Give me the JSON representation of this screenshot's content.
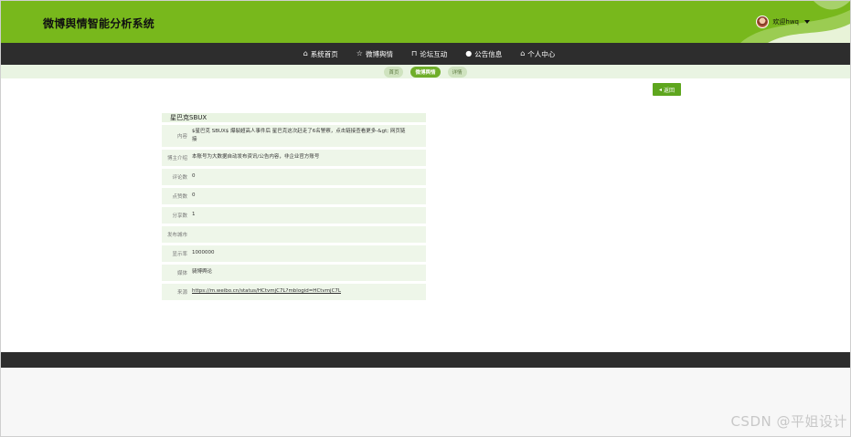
{
  "header": {
    "title": "微博舆情智能分析系统",
    "user_text": "欢迎hwq"
  },
  "nav": {
    "items": [
      {
        "label": "系统首页",
        "icon": "home-icon"
      },
      {
        "label": "微博舆情",
        "icon": "star-icon"
      },
      {
        "label": "论坛互动",
        "icon": "lock-icon"
      },
      {
        "label": "公告信息",
        "icon": "info-icon"
      },
      {
        "label": "个人中心",
        "icon": "home-icon"
      }
    ]
  },
  "breadcrumb": {
    "items": [
      "首页",
      "微博舆情",
      "详情"
    ]
  },
  "back_button": "返回",
  "detail": {
    "title": "星巴克SBUX",
    "rows": [
      {
        "label": "内容",
        "value": "$星巴克 SBUX$ 爆裂超高人事件后 星巴克这次赶走了6名警察，点击链接查看更多-&gt; 网页链接"
      },
      {
        "label": "博主介绍",
        "value": "本账号为大数据自动发布资讯/公告内容，非企业官方账号"
      },
      {
        "label": "评论数",
        "value": "0"
      },
      {
        "label": "点赞数",
        "value": "0"
      },
      {
        "label": "分享数",
        "value": "1"
      },
      {
        "label": "发布城市",
        "value": ""
      },
      {
        "label": "显示率",
        "value": "1000000"
      },
      {
        "label": "媒体",
        "value": "骑博舆论"
      },
      {
        "label": "来源",
        "value": "https://m.weibo.cn/status/HCtvmjC7L?mblogid=HCtvmjC7L"
      }
    ]
  },
  "watermark": "CSDN @平姐设计",
  "colors": {
    "brand_green": "#78b81c",
    "nav_dark": "#2d2d2d",
    "row_bg": "#eef6e9"
  }
}
